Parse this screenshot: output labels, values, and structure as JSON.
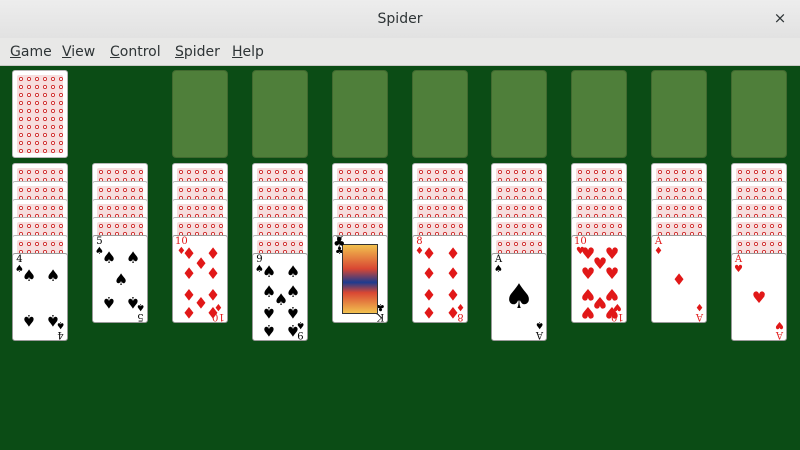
{
  "window": {
    "title": "Spider"
  },
  "menu": [
    "Game",
    "View",
    "Control",
    "Spider",
    "Help"
  ],
  "stock": {
    "visible_backs": 1
  },
  "foundation_slots": 8,
  "columns": [
    {
      "backs": 5,
      "top": {
        "rank": "4",
        "suit": "♠",
        "color": "black"
      }
    },
    {
      "backs": 4,
      "top": {
        "rank": "5",
        "suit": "♠",
        "color": "black"
      }
    },
    {
      "backs": 4,
      "top": {
        "rank": "10",
        "suit": "♦",
        "color": "red"
      }
    },
    {
      "backs": 5,
      "top": {
        "rank": "9",
        "suit": "♠",
        "color": "black"
      }
    },
    {
      "backs": 4,
      "top": {
        "rank": "K",
        "suit": "♣",
        "color": "black"
      }
    },
    {
      "backs": 4,
      "top": {
        "rank": "8",
        "suit": "♦",
        "color": "red"
      }
    },
    {
      "backs": 5,
      "top": {
        "rank": "A",
        "suit": "♠",
        "color": "black"
      }
    },
    {
      "backs": 4,
      "top": {
        "rank": "10",
        "suit": "♥",
        "color": "red"
      }
    },
    {
      "backs": 4,
      "top": {
        "rank": "A",
        "suit": "♦",
        "color": "red"
      }
    },
    {
      "backs": 5,
      "top": {
        "rank": "A",
        "suit": "♥",
        "color": "red"
      }
    }
  ],
  "colors": {
    "felt": "#0b4c15",
    "slot": "#4f7f3a",
    "red_suit": "#e11818"
  }
}
